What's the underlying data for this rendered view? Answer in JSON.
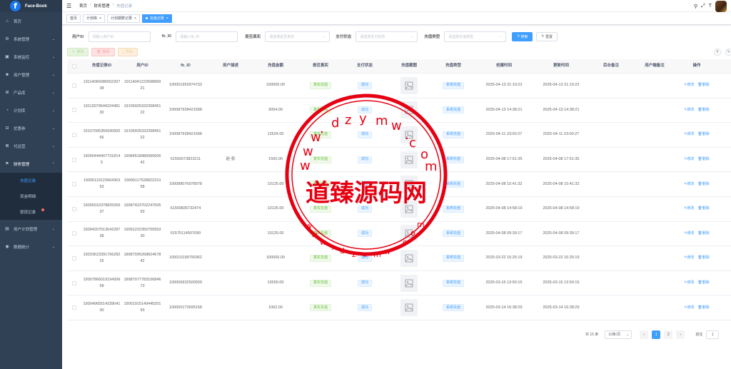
{
  "app": {
    "logo_letter": "f",
    "title": "Face-Book"
  },
  "sidebar": {
    "items": [
      {
        "icon": "home-icon",
        "glyph": "⌂",
        "label": "首页",
        "has_chevron": false
      },
      {
        "icon": "gear-icon",
        "glyph": "⚙",
        "label": "系统管理",
        "has_chevron": true
      },
      {
        "icon": "monitor-icon",
        "glyph": "▣",
        "label": "系统监控",
        "has_chevron": true
      },
      {
        "icon": "user-icon",
        "glyph": "☻",
        "label": "用户管理",
        "has_chevron": true
      },
      {
        "icon": "cart-icon",
        "glyph": "⊞",
        "label": "产品库",
        "has_chevron": true
      },
      {
        "icon": "plan-icon",
        "glyph": "◔",
        "label": "计划库",
        "has_chevron": true
      },
      {
        "icon": "coupon-icon",
        "glyph": "⊟",
        "label": "优惠券",
        "has_chevron": true
      },
      {
        "icon": "agent-icon",
        "glyph": "⊠",
        "label": "代运营",
        "has_chevron": true
      },
      {
        "icon": "finance-icon",
        "glyph": "⚑",
        "label": "财务管理",
        "has_chevron": true,
        "expanded": true
      }
    ],
    "finance_sub": [
      "充值记录",
      "资金明细",
      "提现记录"
    ],
    "items_after": [
      {
        "icon": "user-plan-icon",
        "glyph": "▤",
        "label": "用户计划管理",
        "has_chevron": true
      },
      {
        "icon": "stats-icon",
        "glyph": "◉",
        "label": "数据统计",
        "has_chevron": true
      }
    ]
  },
  "header": {
    "breadcrumb": [
      "首页",
      "财务管理",
      "充值记录"
    ]
  },
  "tags": [
    {
      "label": "首页",
      "closable": false,
      "active": false
    },
    {
      "label": "计划库",
      "closable": true,
      "active": false
    },
    {
      "label": "计划期数记录",
      "closable": true,
      "active": false
    },
    {
      "label": "充值记录",
      "closable": true,
      "active": true
    }
  ],
  "search": {
    "user_id_label": "用户ID",
    "user_id_placeholder": "请输入用户ID",
    "fb_id_label": "fb_ID",
    "fb_id_placeholder": "请输入fb_ID",
    "real_label": "是否真实",
    "real_placeholder": "请选择是否真实",
    "pay_label": "支付状态",
    "pay_placeholder": "请选择支付状态",
    "type_label": "充值类型",
    "type_placeholder": "请选择充值类型",
    "search_btn": "搜索",
    "reset_btn": "重置"
  },
  "toolbar": {
    "edit": "修改",
    "delete": "删除",
    "export": "导出"
  },
  "table": {
    "columns": [
      "充值记录ID",
      "用户ID",
      "fb_ID",
      "用户描述",
      "充值金额",
      "是否真实",
      "支付状态",
      "充值截图",
      "充值类型",
      "创建时间",
      "更新时间",
      "后台备注",
      "用户端备注",
      "操作"
    ],
    "op_edit": "修改",
    "op_delete": "删除",
    "rows": [
      {
        "record_id": "1911406608655220738",
        "user_id": "1911404122359889921",
        "fb_id": "100001953974733",
        "desc": "",
        "amount": "100000.00",
        "real": "真实充值",
        "pay": "成功",
        "type": "系统充值",
        "created": "2025-04-13 21:10:22",
        "updated": "2025-04-13 21:10:22"
      },
      {
        "record_id": "1911307954422448130",
        "user_id": "1910692633235845122",
        "fb_id": "100087928421698",
        "desc": "",
        "amount": "3094.00",
        "real": "真实充值",
        "pay": "成功",
        "type": "系统充值",
        "created": "2025-04-13 14:38:21",
        "updated": "2025-04-13 14:38:21"
      },
      {
        "record_id": "1910709535593099266",
        "user_id": "1910692633235845122",
        "fb_id": "100087928421698",
        "desc": "",
        "amount": "12624.00",
        "real": "真实充值",
        "pay": "成功",
        "type": "系统充值",
        "created": "2025-04-11 23:00:27",
        "updated": "2025-04-11 23:00:27"
      },
      {
        "record_id": "1909544440773181​45",
        "user_id": "1908451898696560642",
        "fb_id": "61556573823211",
        "desc": "赵-张",
        "amount": "1500.00",
        "real": "真实充值",
        "pay": "成功",
        "type": "系统充值",
        "created": "2025-04-08 17:51:35",
        "updated": "2025-04-08 17:51:35"
      },
      {
        "record_id": "1909511912366436353",
        "user_id": "1909511752882221058",
        "fb_id": "100088076978078",
        "desc": "",
        "amount": "10125.00",
        "real": "真实充值",
        "pay": "成功",
        "type": "系统充值",
        "created": "2025-04-08 15:41:32",
        "updated": "2025-04-08 15:41:32"
      },
      {
        "record_id": "1909501037882535937",
        "user_id": "1908742370224750593",
        "fb_id": "61559835732474",
        "desc": "",
        "amount": "10125.00",
        "real": "真实充值",
        "pay": "成功",
        "type": "系统充值",
        "created": "2025-04-08 14:58:19",
        "updated": "2025-04-08 14:58:19"
      },
      {
        "record_id": "1909420751354228738",
        "user_id": "1909122235075555330",
        "fb_id": "61575114507090",
        "desc": "",
        "amount": "10125.00",
        "real": "真实充值",
        "pay": "成功",
        "type": "系统充值",
        "created": "2025-04-08 09:39:17",
        "updated": "2025-04-08 09:39:17"
      },
      {
        "record_id": "1903362339176628225",
        "user_id": "1898709526882467842",
        "fb_id": "100010199790362",
        "desc": "",
        "amount": "100000.00",
        "real": "真实充值",
        "pay": "成功",
        "type": "系统充值",
        "created": "2025-03-22 16:25:19",
        "updated": "2025-03-22 16:25:19"
      },
      {
        "record_id": "1900786601919430658",
        "user_id": "1898707778310684673",
        "fb_id": "100006932500939",
        "desc": "",
        "amount": "10000.00",
        "real": "真实充值",
        "pay": "成功",
        "type": "系统充值",
        "created": "2025-03-15 13:50:15",
        "updated": "2025-03-15 13:50:15"
      },
      {
        "record_id": "1900496551433904130",
        "user_id": "1900191514944520193",
        "fb_id": "100000173695158",
        "desc": "",
        "amount": "1062.00",
        "real": "真实充值",
        "pay": "成功",
        "type": "系统充值",
        "created": "2025-03-14 16:38:29",
        "updated": "2025-03-14 16:38:29"
      }
    ]
  },
  "pager": {
    "total": "共 15 条",
    "page_size": "10条/页",
    "pages": [
      "1",
      "2"
    ],
    "jump_label": "前往",
    "jump_value": "1"
  },
  "watermark": {
    "text_cn": "道臻源码网",
    "text_url": "www.dzymw.com"
  },
  "colors": {
    "sidebar_bg": "#304156",
    "accent": "#409eff",
    "watermark": "#e60012"
  }
}
